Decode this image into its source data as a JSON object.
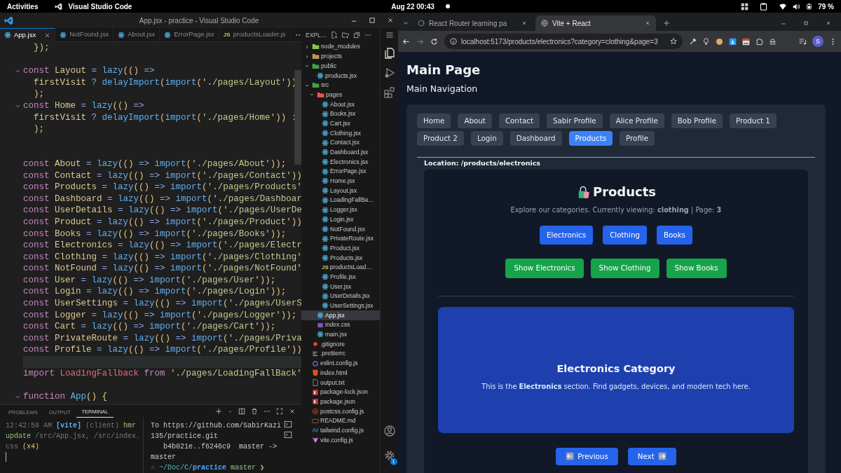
{
  "top_bar": {
    "activities": "Activities",
    "app_name": "Visual Studio Code",
    "clock": "Aug 22  00:43",
    "battery": "79 %"
  },
  "vscode": {
    "title": "App.jsx - practice - Visual Studio Code",
    "tabs": [
      {
        "label": "App.jsx",
        "kind": "react",
        "selected": true
      },
      {
        "label": "NotFound.jsx",
        "kind": "react",
        "selected": false
      },
      {
        "label": "About.jsx",
        "kind": "react",
        "selected": false
      },
      {
        "label": "ErrorPage.jsx",
        "kind": "react",
        "selected": false
      },
      {
        "label": "productsLoader.js",
        "kind": "js",
        "badge": "JS",
        "selected": false
      }
    ],
    "explorer_title": "EXPL…",
    "code_lines": [
      {
        "tokens": [
          {
            "kind": "pn",
            "text": "  })"
          },
          {
            "kind": "pl",
            "text": ";"
          }
        ]
      },
      {
        "kind": "blank"
      },
      {
        "expanded": true,
        "tokens": [
          {
            "kind": "kw",
            "text": "const "
          },
          {
            "kind": "id",
            "text": "Layout"
          },
          {
            "kind": "op",
            "text": " = "
          },
          {
            "kind": "fn",
            "text": "lazy"
          },
          {
            "kind": "pn",
            "text": "(() "
          },
          {
            "kind": "op",
            "text": "=>"
          }
        ]
      },
      {
        "tokens": [
          {
            "kind": "id",
            "text": "  firstVisit "
          },
          {
            "kind": "op",
            "text": "? "
          },
          {
            "kind": "fn",
            "text": "delayImport"
          },
          {
            "kind": "pn",
            "text": "("
          },
          {
            "kind": "fn",
            "text": "import"
          },
          {
            "kind": "pn",
            "text": "("
          },
          {
            "kind": "str",
            "text": "'./pages/Layout'"
          },
          {
            "kind": "pn",
            "text": "))"
          }
        ]
      },
      {
        "tokens": [
          {
            "kind": "pn",
            "text": "  );"
          }
        ]
      },
      {
        "expanded": true,
        "tokens": [
          {
            "kind": "kw",
            "text": "const "
          },
          {
            "kind": "id",
            "text": "Home"
          },
          {
            "kind": "op",
            "text": " = "
          },
          {
            "kind": "fn",
            "text": "lazy"
          },
          {
            "kind": "pn",
            "text": "(() "
          },
          {
            "kind": "op",
            "text": "=>"
          }
        ]
      },
      {
        "tokens": [
          {
            "kind": "id",
            "text": "  firstVisit "
          },
          {
            "kind": "op",
            "text": "? "
          },
          {
            "kind": "fn",
            "text": "delayImport"
          },
          {
            "kind": "pn",
            "text": "("
          },
          {
            "kind": "fn",
            "text": "import"
          },
          {
            "kind": "pn",
            "text": "("
          },
          {
            "kind": "str",
            "text": "'./pages/Home'"
          },
          {
            "kind": "pn",
            "text": "))"
          },
          {
            "kind": "op",
            "text": " :"
          }
        ]
      },
      {
        "tokens": [
          {
            "kind": "pn",
            "text": "  );"
          }
        ]
      },
      {
        "kind": "blank"
      },
      {
        "kind": "blank"
      },
      {
        "tokens": [
          {
            "kind": "kw",
            "text": "const "
          },
          {
            "kind": "id",
            "text": "About"
          },
          {
            "kind": "op",
            "text": " = "
          },
          {
            "kind": "fn",
            "text": "lazy"
          },
          {
            "kind": "pn",
            "text": "(() "
          },
          {
            "kind": "op",
            "text": "=> "
          },
          {
            "kind": "fn",
            "text": "import"
          },
          {
            "kind": "pn",
            "text": "("
          },
          {
            "kind": "str",
            "text": "'./pages/About'"
          },
          {
            "kind": "pn",
            "text": "));"
          }
        ]
      },
      {
        "tokens": [
          {
            "kind": "kw",
            "text": "const "
          },
          {
            "kind": "id",
            "text": "Contact"
          },
          {
            "kind": "op",
            "text": " = "
          },
          {
            "kind": "fn",
            "text": "lazy"
          },
          {
            "kind": "pn",
            "text": "(() "
          },
          {
            "kind": "op",
            "text": "=> "
          },
          {
            "kind": "fn",
            "text": "import"
          },
          {
            "kind": "pn",
            "text": "("
          },
          {
            "kind": "str",
            "text": "'./pages/Contact'"
          },
          {
            "kind": "pn",
            "text": "))"
          }
        ]
      },
      {
        "tokens": [
          {
            "kind": "kw",
            "text": "const "
          },
          {
            "kind": "id",
            "text": "Products"
          },
          {
            "kind": "op",
            "text": " = "
          },
          {
            "kind": "fn",
            "text": "lazy"
          },
          {
            "kind": "pn",
            "text": "(() "
          },
          {
            "kind": "op",
            "text": "=> "
          },
          {
            "kind": "fn",
            "text": "import"
          },
          {
            "kind": "pn",
            "text": "("
          },
          {
            "kind": "str",
            "text": "'./pages/Products'"
          }
        ]
      },
      {
        "tokens": [
          {
            "kind": "kw",
            "text": "const "
          },
          {
            "kind": "id",
            "text": "Dashboard"
          },
          {
            "kind": "op",
            "text": " = "
          },
          {
            "kind": "fn",
            "text": "lazy"
          },
          {
            "kind": "pn",
            "text": "(() "
          },
          {
            "kind": "op",
            "text": "=> "
          },
          {
            "kind": "fn",
            "text": "import"
          },
          {
            "kind": "pn",
            "text": "("
          },
          {
            "kind": "str",
            "text": "'./pages/Dashboar"
          }
        ]
      },
      {
        "tokens": [
          {
            "kind": "kw",
            "text": "const "
          },
          {
            "kind": "id",
            "text": "UserDetails"
          },
          {
            "kind": "op",
            "text": " = "
          },
          {
            "kind": "fn",
            "text": "lazy"
          },
          {
            "kind": "pn",
            "text": "(() "
          },
          {
            "kind": "op",
            "text": "=> "
          },
          {
            "kind": "fn",
            "text": "import"
          },
          {
            "kind": "pn",
            "text": "("
          },
          {
            "kind": "str",
            "text": "'./pages/UserDe"
          }
        ]
      },
      {
        "tokens": [
          {
            "kind": "kw",
            "text": "const "
          },
          {
            "kind": "id",
            "text": "Product"
          },
          {
            "kind": "op",
            "text": " = "
          },
          {
            "kind": "fn",
            "text": "lazy"
          },
          {
            "kind": "pn",
            "text": "(() "
          },
          {
            "kind": "op",
            "text": "=> "
          },
          {
            "kind": "fn",
            "text": "import"
          },
          {
            "kind": "pn",
            "text": "("
          },
          {
            "kind": "str",
            "text": "'./pages/Product'"
          },
          {
            "kind": "pn",
            "text": "))"
          }
        ]
      },
      {
        "tokens": [
          {
            "kind": "kw",
            "text": "const "
          },
          {
            "kind": "id",
            "text": "Books"
          },
          {
            "kind": "op",
            "text": " = "
          },
          {
            "kind": "fn",
            "text": "lazy"
          },
          {
            "kind": "pn",
            "text": "(() "
          },
          {
            "kind": "op",
            "text": "=> "
          },
          {
            "kind": "fn",
            "text": "import"
          },
          {
            "kind": "pn",
            "text": "("
          },
          {
            "kind": "str",
            "text": "'./pages/Books'"
          },
          {
            "kind": "pn",
            "text": "));"
          }
        ]
      },
      {
        "tokens": [
          {
            "kind": "kw",
            "text": "const "
          },
          {
            "kind": "id",
            "text": "Electronics"
          },
          {
            "kind": "op",
            "text": " = "
          },
          {
            "kind": "fn",
            "text": "lazy"
          },
          {
            "kind": "pn",
            "text": "(() "
          },
          {
            "kind": "op",
            "text": "=> "
          },
          {
            "kind": "fn",
            "text": "import"
          },
          {
            "kind": "pn",
            "text": "("
          },
          {
            "kind": "str",
            "text": "'./pages/Electr"
          }
        ]
      },
      {
        "tokens": [
          {
            "kind": "kw",
            "text": "const "
          },
          {
            "kind": "id",
            "text": "Clothing"
          },
          {
            "kind": "op",
            "text": " = "
          },
          {
            "kind": "fn",
            "text": "lazy"
          },
          {
            "kind": "pn",
            "text": "(() "
          },
          {
            "kind": "op",
            "text": "=> "
          },
          {
            "kind": "fn",
            "text": "import"
          },
          {
            "kind": "pn",
            "text": "("
          },
          {
            "kind": "str",
            "text": "'./pages/Clothing'"
          }
        ]
      },
      {
        "tokens": [
          {
            "kind": "kw",
            "text": "const "
          },
          {
            "kind": "id",
            "text": "NotFound"
          },
          {
            "kind": "op",
            "text": " = "
          },
          {
            "kind": "fn",
            "text": "lazy"
          },
          {
            "kind": "pn",
            "text": "(() "
          },
          {
            "kind": "op",
            "text": "=> "
          },
          {
            "kind": "fn",
            "text": "import"
          },
          {
            "kind": "pn",
            "text": "("
          },
          {
            "kind": "str",
            "text": "'./pages/NotFound'"
          }
        ]
      },
      {
        "tokens": [
          {
            "kind": "kw",
            "text": "const "
          },
          {
            "kind": "id",
            "text": "User"
          },
          {
            "kind": "op",
            "text": " = "
          },
          {
            "kind": "fn",
            "text": "lazy"
          },
          {
            "kind": "pn",
            "text": "(() "
          },
          {
            "kind": "op",
            "text": "=> "
          },
          {
            "kind": "fn",
            "text": "import"
          },
          {
            "kind": "pn",
            "text": "("
          },
          {
            "kind": "str",
            "text": "'./pages/User'"
          },
          {
            "kind": "pn",
            "text": "));"
          }
        ]
      },
      {
        "tokens": [
          {
            "kind": "kw",
            "text": "const "
          },
          {
            "kind": "id",
            "text": "Login"
          },
          {
            "kind": "op",
            "text": " = "
          },
          {
            "kind": "fn",
            "text": "lazy"
          },
          {
            "kind": "pn",
            "text": "(() "
          },
          {
            "kind": "op",
            "text": "=> "
          },
          {
            "kind": "fn",
            "text": "import"
          },
          {
            "kind": "pn",
            "text": "("
          },
          {
            "kind": "str",
            "text": "'./pages/Login'"
          },
          {
            "kind": "pn",
            "text": "));"
          }
        ]
      },
      {
        "tokens": [
          {
            "kind": "kw",
            "text": "const "
          },
          {
            "kind": "id",
            "text": "UserSettings"
          },
          {
            "kind": "op",
            "text": " = "
          },
          {
            "kind": "fn",
            "text": "lazy"
          },
          {
            "kind": "pn",
            "text": "(() "
          },
          {
            "kind": "op",
            "text": "=> "
          },
          {
            "kind": "fn",
            "text": "import"
          },
          {
            "kind": "pn",
            "text": "("
          },
          {
            "kind": "str",
            "text": "'./pages/UserS"
          }
        ]
      },
      {
        "tokens": [
          {
            "kind": "kw",
            "text": "const "
          },
          {
            "kind": "id",
            "text": "Logger"
          },
          {
            "kind": "op",
            "text": " = "
          },
          {
            "kind": "fn",
            "text": "lazy"
          },
          {
            "kind": "pn",
            "text": "(() "
          },
          {
            "kind": "op",
            "text": "=> "
          },
          {
            "kind": "fn",
            "text": "import"
          },
          {
            "kind": "pn",
            "text": "("
          },
          {
            "kind": "str",
            "text": "'./pages/Logger'"
          },
          {
            "kind": "pn",
            "text": "));"
          }
        ]
      },
      {
        "tokens": [
          {
            "kind": "kw",
            "text": "const "
          },
          {
            "kind": "id",
            "text": "Cart"
          },
          {
            "kind": "op",
            "text": " = "
          },
          {
            "kind": "fn",
            "text": "lazy"
          },
          {
            "kind": "pn",
            "text": "(() "
          },
          {
            "kind": "op",
            "text": "=> "
          },
          {
            "kind": "fn",
            "text": "import"
          },
          {
            "kind": "pn",
            "text": "("
          },
          {
            "kind": "str",
            "text": "'./pages/Cart'"
          },
          {
            "kind": "pn",
            "text": "));"
          }
        ]
      },
      {
        "tokens": [
          {
            "kind": "kw",
            "text": "const "
          },
          {
            "kind": "id",
            "text": "PrivateRoute"
          },
          {
            "kind": "op",
            "text": " = "
          },
          {
            "kind": "fn",
            "text": "lazy"
          },
          {
            "kind": "pn",
            "text": "(() "
          },
          {
            "kind": "op",
            "text": "=> "
          },
          {
            "kind": "fn",
            "text": "import"
          },
          {
            "kind": "pn",
            "text": "("
          },
          {
            "kind": "str",
            "text": "'./pages/Priva"
          }
        ]
      },
      {
        "tokens": [
          {
            "kind": "kw",
            "text": "const "
          },
          {
            "kind": "id",
            "text": "Profile"
          },
          {
            "kind": "op",
            "text": " = "
          },
          {
            "kind": "fn",
            "text": "lazy"
          },
          {
            "kind": "pn",
            "text": "(() "
          },
          {
            "kind": "op",
            "text": "=> "
          },
          {
            "kind": "fn",
            "text": "import"
          },
          {
            "kind": "pn",
            "text": "("
          },
          {
            "kind": "str",
            "text": "'./pages/Profile'"
          },
          {
            "kind": "pn",
            "text": "))"
          }
        ]
      },
      {
        "kind": "blank",
        "current": true
      },
      {
        "tokens": [
          {
            "kind": "kw",
            "text": "import "
          },
          {
            "kind": "cls",
            "text": "LoadingFallback "
          },
          {
            "kind": "kw",
            "text": "from "
          },
          {
            "kind": "str",
            "text": "'./pages/LoadingFallBack'"
          }
        ]
      },
      {
        "kind": "blank"
      },
      {
        "expanded": true,
        "tokens": [
          {
            "kind": "kw",
            "text": "function "
          },
          {
            "kind": "fn",
            "text": "App"
          },
          {
            "kind": "pn",
            "text": "() {"
          }
        ]
      }
    ],
    "explorer_tree": [
      {
        "label": "node_modules",
        "kind": "folder",
        "color": "#8bc34a",
        "expanded": false,
        "selected": false
      },
      {
        "label": "projects",
        "kind": "folder",
        "color": "#c09553",
        "expanded": false,
        "selected": false
      },
      {
        "label": "public",
        "kind": "folder",
        "color": "#43a047",
        "expanded": true,
        "selected": false,
        "children": [
          {
            "label": "products.jsx",
            "kind": "react",
            "selected": false
          }
        ]
      },
      {
        "label": "src",
        "kind": "folder",
        "color": "#43a047",
        "expanded": true,
        "selected": false,
        "children": [
          {
            "label": "pages",
            "kind": "folder",
            "color": "#ef5350",
            "expanded": true,
            "selected": false,
            "children": [
              {
                "label": "About.jsx",
                "kind": "react",
                "selected": false
              },
              {
                "label": "Books.jsx",
                "kind": "react",
                "selected": false
              },
              {
                "label": "Cart.jsx",
                "kind": "react",
                "selected": false
              },
              {
                "label": "Clothing.jsx",
                "kind": "react",
                "selected": false
              },
              {
                "label": "Contact.jsx",
                "kind": "react",
                "selected": false
              },
              {
                "label": "Dashboard.jsx",
                "kind": "react",
                "selected": false
              },
              {
                "label": "Electronics.jsx",
                "kind": "react",
                "selected": false
              },
              {
                "label": "ErrorPage.jsx",
                "kind": "react",
                "selected": false
              },
              {
                "label": "Home.jsx",
                "kind": "react",
                "selected": false
              },
              {
                "label": "Layout.jsx",
                "kind": "react",
                "selected": false
              },
              {
                "label": "LoadingFallBa…",
                "kind": "react",
                "selected": false
              },
              {
                "label": "Logger.jsx",
                "kind": "react",
                "selected": false
              },
              {
                "label": "Login.jsx",
                "kind": "react",
                "selected": false
              },
              {
                "label": "NotFound.jsx",
                "kind": "react",
                "selected": false
              },
              {
                "label": "PrivateRoute.jsx",
                "kind": "react",
                "selected": false
              },
              {
                "label": "Product.jsx",
                "kind": "react",
                "selected": false
              },
              {
                "label": "Products.jsx",
                "kind": "react",
                "selected": false
              },
              {
                "label": "productsLoad…",
                "kind": "js",
                "badge": "JS",
                "selected": false
              },
              {
                "label": "Profile.jsx",
                "kind": "react",
                "selected": false
              },
              {
                "label": "User.jsx",
                "kind": "react",
                "selected": false
              },
              {
                "label": "UserDetails.jsx",
                "kind": "react",
                "selected": false
              },
              {
                "label": "UserSettings.jsx",
                "kind": "react",
                "selected": false
              }
            ]
          },
          {
            "label": "App.jsx",
            "kind": "react",
            "selected": true
          },
          {
            "label": "index.css",
            "kind": "css",
            "selected": false
          },
          {
            "label": "main.jsx",
            "kind": "react",
            "selected": false
          }
        ]
      },
      {
        "label": ".gitignore",
        "kind": "git",
        "selected": false
      },
      {
        "label": ".prettierrc",
        "kind": "prettier",
        "selected": false
      },
      {
        "label": "eslint.config.js",
        "kind": "eslint",
        "selected": false
      },
      {
        "label": "index.html",
        "kind": "html",
        "selected": false
      },
      {
        "label": "output.txt",
        "kind": "text",
        "selected": false
      },
      {
        "label": "package-lock.json",
        "kind": "npm",
        "selected": false
      },
      {
        "label": "package.json",
        "kind": "npm",
        "selected": false
      },
      {
        "label": "postcss.config.js",
        "kind": "postcss",
        "selected": false
      },
      {
        "label": "README.md",
        "kind": "markdown",
        "selected": false
      },
      {
        "label": "tailwind.config.js",
        "kind": "tailwind",
        "selected": false
      },
      {
        "label": "vite.config.js",
        "kind": "vite",
        "selected": false
      }
    ],
    "panel_tabs": [
      {
        "label": "PROBLEMS",
        "selected": false
      },
      {
        "label": "OUTPUT",
        "selected": false
      },
      {
        "label": "TERMINAL",
        "selected": true
      }
    ],
    "terminal_left": [
      {
        "kind": "dim",
        "text": "12:42:58 AM "
      },
      {
        "kind": "vite",
        "text": "[vite] "
      },
      {
        "kind": "dim",
        "text": "(client) "
      },
      {
        "kind": "grn",
        "text": "hmr update "
      },
      {
        "kind": "dim",
        "text": "/src/App.jsx, /src/index.css "
      },
      {
        "kind": "ylw",
        "text": "(x4)"
      }
    ],
    "terminal_right": [
      "To https://github.com/SabirKazi135/practice.git",
      "   b4b021e..f6246c9  master -> master"
    ],
    "terminal_prompt": [
      {
        "kind": "dim",
        "text": "○ "
      },
      {
        "kind": "cyan",
        "text": "~/Doc/C/"
      },
      {
        "kind": "bold",
        "text": "practice "
      },
      {
        "kind": "grn",
        "text": "master "
      },
      {
        "kind": "ylw",
        "text": "❯"
      }
    ],
    "settings_badge": "1"
  },
  "browser": {
    "tabs": [
      {
        "title": "React Router learning pa",
        "selected": false
      },
      {
        "title": "Vite + React",
        "selected": true
      }
    ],
    "nav_buttons": [
      {
        "kind": "back",
        "disabled": false
      },
      {
        "kind": "forward",
        "disabled": true
      },
      {
        "kind": "reload",
        "disabled": false
      }
    ],
    "url": "localhost:5173/products/electronics?category=clothing&page=3",
    "profile_initial": "S",
    "page": {
      "title": "Main Page",
      "subtitle": "Main Navigation",
      "nav": [
        {
          "label": "Home",
          "selected": false
        },
        {
          "label": "About",
          "selected": false
        },
        {
          "label": "Contact",
          "selected": false
        },
        {
          "label": "Sabir Profile",
          "selected": false
        },
        {
          "label": "Alice Profile",
          "selected": false
        },
        {
          "label": "Bob Profile",
          "selected": false
        },
        {
          "label": "Product 1",
          "selected": false
        },
        {
          "label": "Product 2",
          "selected": false
        },
        {
          "label": "Login",
          "selected": false
        },
        {
          "label": "Dashboard",
          "selected": false
        },
        {
          "label": "Products",
          "selected": true
        },
        {
          "label": "Profile",
          "selected": false
        }
      ],
      "location": "Location: /products/electronics",
      "heading": "Products",
      "description": "Explore our categories. Currently viewing: **clothing** | Page: **3**",
      "category_buttons": [
        "Electronics",
        "Clothing",
        "Books"
      ],
      "show_buttons": [
        "Show Electronics",
        "Show Clothing",
        "Show Books"
      ],
      "panel_title": "Electronics Category",
      "panel_text": "This is the **Electronics** section. Find gadgets, devices, and modern tech here.",
      "previous": "Previous",
      "next": "Next"
    }
  }
}
